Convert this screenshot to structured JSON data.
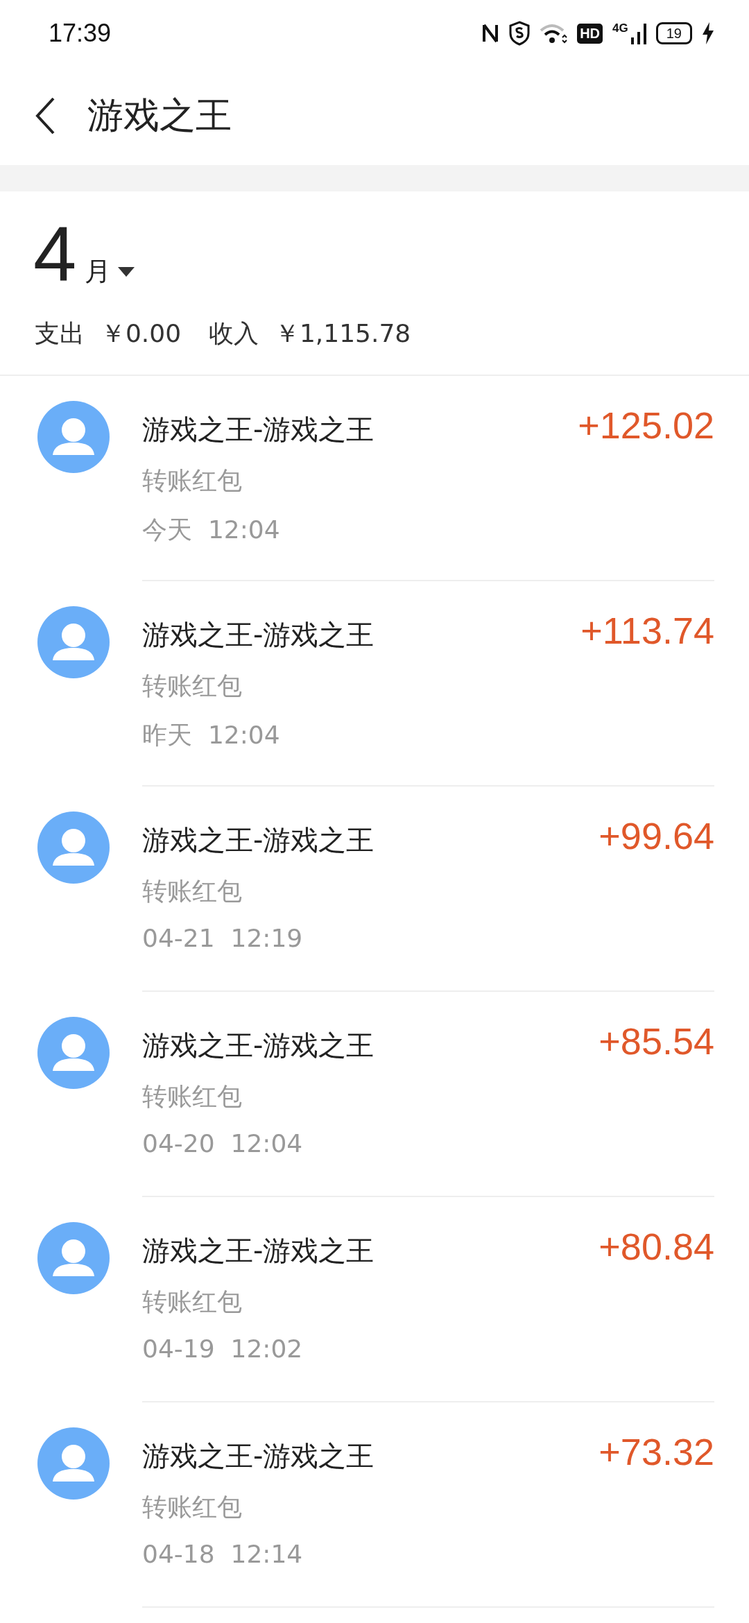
{
  "status_bar": {
    "time": "17:39",
    "hd": "HD",
    "network": "4G",
    "battery": "19"
  },
  "header": {
    "title": "游戏之王"
  },
  "month": {
    "number": "4",
    "unit": "月"
  },
  "summary": [
    {
      "label": "支出",
      "amount": "￥0.00"
    },
    {
      "label": "收入",
      "amount": "￥1,115.78"
    }
  ],
  "transactions": [
    {
      "title": "游戏之王-游戏之王",
      "type": "转账红包",
      "date": "今天",
      "time": "12:04",
      "amount": "+125.02"
    },
    {
      "title": "游戏之王-游戏之王",
      "type": "转账红包",
      "date": "昨天",
      "time": "12:04",
      "amount": "+113.74"
    },
    {
      "title": "游戏之王-游戏之王",
      "type": "转账红包",
      "date": "04-21",
      "time": "12:19",
      "amount": "+99.64"
    },
    {
      "title": "游戏之王-游戏之王",
      "type": "转账红包",
      "date": "04-20",
      "time": "12:04",
      "amount": "+85.54"
    },
    {
      "title": "游戏之王-游戏之王",
      "type": "转账红包",
      "date": "04-19",
      "time": "12:02",
      "amount": "+80.84"
    },
    {
      "title": "游戏之王-游戏之王",
      "type": "转账红包",
      "date": "04-18",
      "time": "12:14",
      "amount": "+73.32"
    }
  ]
}
